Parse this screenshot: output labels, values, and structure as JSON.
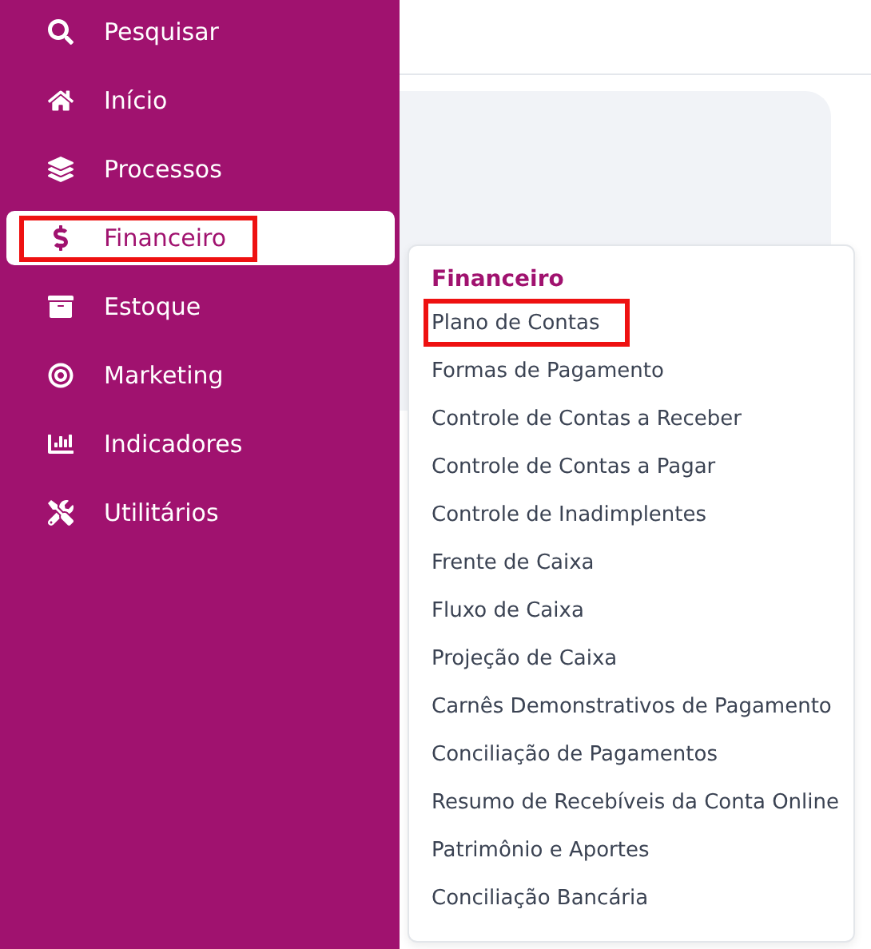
{
  "sidebar": {
    "items": [
      {
        "label": "Pesquisar",
        "selected": false,
        "highlighted": false
      },
      {
        "label": "Início",
        "selected": false,
        "highlighted": false
      },
      {
        "label": "Processos",
        "selected": false,
        "highlighted": false
      },
      {
        "label": "Financeiro",
        "selected": true,
        "highlighted": true
      },
      {
        "label": "Estoque",
        "selected": false,
        "highlighted": false
      },
      {
        "label": "Marketing",
        "selected": false,
        "highlighted": false
      },
      {
        "label": "Indicadores",
        "selected": false,
        "highlighted": false
      },
      {
        "label": "Utilitários",
        "selected": false,
        "highlighted": false
      }
    ]
  },
  "submenu": {
    "title": "Financeiro",
    "items": [
      {
        "label": "Plano de Contas",
        "highlighted": true
      },
      {
        "label": "Formas de Pagamento",
        "highlighted": false
      },
      {
        "label": "Controle de Contas a Receber",
        "highlighted": false
      },
      {
        "label": "Controle de Contas a Pagar",
        "highlighted": false
      },
      {
        "label": "Controle de Inadimplentes",
        "highlighted": false
      },
      {
        "label": "Frente de Caixa",
        "highlighted": false
      },
      {
        "label": "Fluxo de Caixa",
        "highlighted": false
      },
      {
        "label": "Projeção de Caixa",
        "highlighted": false
      },
      {
        "label": "Carnês Demonstrativos de Pagamento",
        "highlighted": false
      },
      {
        "label": "Conciliação de Pagamentos",
        "highlighted": false
      },
      {
        "label": "Resumo de Recebíveis da Conta Online",
        "highlighted": false
      },
      {
        "label": "Patrimônio e Aportes",
        "highlighted": false
      },
      {
        "label": "Conciliação Bancária",
        "highlighted": false
      }
    ]
  }
}
